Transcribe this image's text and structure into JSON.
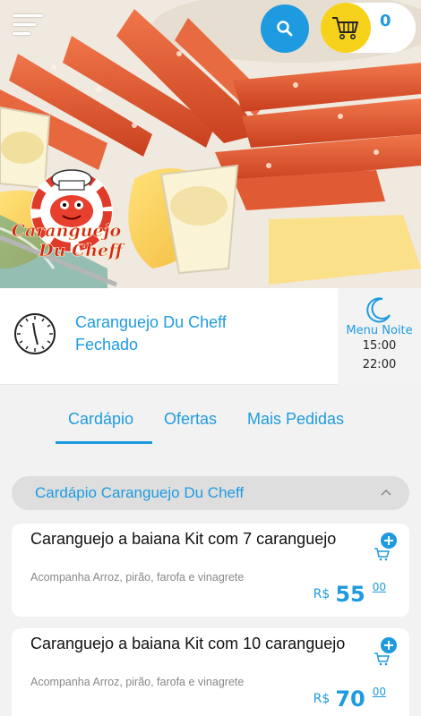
{
  "header": {
    "cart_count": "0",
    "colors": {
      "accent": "#1e9be0",
      "cart": "#f7d21b"
    }
  },
  "logo": {
    "line1": "Caranguejo",
    "line2": "Du Cheff"
  },
  "store": {
    "name": "Caranguejo Du Cheff",
    "status": "Fechado",
    "shift_label": "Menu Noite",
    "open_time": "15:00",
    "close_time": "22:00"
  },
  "tabs": [
    {
      "label": "Cardápio"
    },
    {
      "label": "Ofertas"
    },
    {
      "label": "Mais Pedidas"
    }
  ],
  "category": {
    "title": "Cardápio Caranguejo Du Cheff"
  },
  "products": [
    {
      "title": "Caranguejo a baiana Kit com 7 caranguejo",
      "description": "Acompanha Arroz, pirão, farofa e vinagrete",
      "currency": "R$",
      "price_int": "55",
      "price_cents": "00"
    },
    {
      "title": "Caranguejo a baiana Kit com 10 caranguejo",
      "description": "Acompanha Arroz, pirão, farofa e vinagrete",
      "currency": "R$",
      "price_int": "70",
      "price_cents": "00"
    }
  ]
}
